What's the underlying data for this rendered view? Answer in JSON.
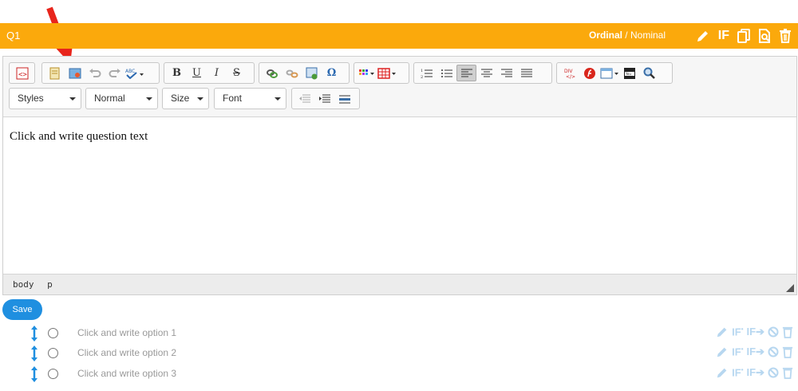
{
  "question": {
    "number": "Q1",
    "type_primary": "Ordinal",
    "type_sep": " / ",
    "type_secondary": "Nominal",
    "actions": {
      "if_label": "IF"
    }
  },
  "toolbar": {
    "row1_groups": [
      [
        "source-icon"
      ],
      [
        "templates-icon",
        "image-icon",
        "undo-icon",
        "redo-icon",
        "spellcheck-icon"
      ],
      [
        "bold-icon",
        "underline-icon",
        "italic-icon",
        "strike-icon"
      ],
      [
        "link-icon",
        "unlink-icon",
        "anchor-icon",
        "special-char-icon"
      ],
      [
        "text-color-icon",
        "table-icon"
      ],
      [
        "numbered-list-icon",
        "bullet-list-icon",
        "align-left-icon",
        "align-center-icon",
        "align-right-icon",
        "justify-icon"
      ],
      [
        "div-icon",
        "flash-icon",
        "iframe-icon",
        "youtube-icon",
        "find-icon"
      ]
    ],
    "combos": {
      "styles": "Styles",
      "format": "Normal",
      "size": "Size",
      "font": "Font"
    },
    "glyphs": {
      "bold": "B",
      "underline": "U",
      "italic": "I",
      "strike": "S",
      "omega": "Ω",
      "div": "DIV"
    }
  },
  "editor": {
    "content_text": "Click and write question text",
    "status_path": [
      "body",
      "p"
    ]
  },
  "save_label": "Save",
  "options": [
    {
      "label": "Click and write option 1"
    },
    {
      "label": "Click and write option 2"
    },
    {
      "label": "Click and write option 3"
    }
  ],
  "option_actions": {
    "if_in": "IF",
    "if_to": "IF"
  },
  "colors": {
    "header_bg": "#fba90c",
    "save_bg": "#1f8fe0",
    "option_icon": "#b7d7f0",
    "drag_icon": "#1f8fe0",
    "annotation_arrow": "#e8251c"
  }
}
